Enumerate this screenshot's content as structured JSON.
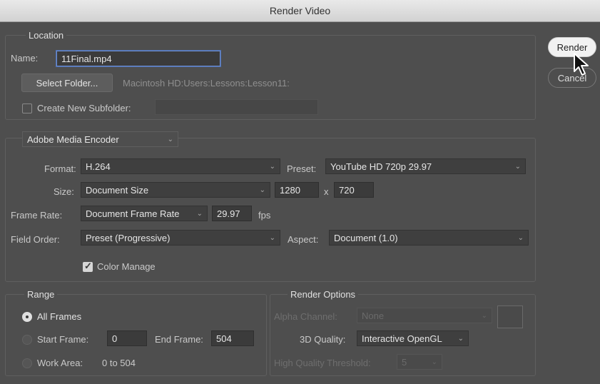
{
  "window": {
    "title": "Render Video"
  },
  "location": {
    "legend": "Location",
    "name_label": "Name:",
    "name_value": "11Final.mp4",
    "select_folder_label": "Select Folder...",
    "folder_path": "Macintosh HD:Users:Lessons:Lesson11:",
    "create_subfolder_label": "Create New Subfolder:",
    "create_subfolder_checked": false,
    "subfolder_value": ""
  },
  "encoder": {
    "selected": "Adobe Media Encoder",
    "format_label": "Format:",
    "format_value": "H.264",
    "preset_label": "Preset:",
    "preset_value": "YouTube HD 720p 29.97",
    "size_label": "Size:",
    "size_value": "Document Size",
    "width": "1280",
    "x_label": "x",
    "height": "720",
    "frame_rate_label": "Frame Rate:",
    "frame_rate_value": "Document Frame Rate",
    "fps_value": "29.97",
    "fps_label": "fps",
    "field_order_label": "Field Order:",
    "field_order_value": "Preset (Progressive)",
    "aspect_label": "Aspect:",
    "aspect_value": "Document (1.0)",
    "color_manage_label": "Color Manage",
    "color_manage_checked": true
  },
  "range": {
    "legend": "Range",
    "all_frames_label": "All Frames",
    "start_frame_label": "Start Frame:",
    "start_frame_value": "0",
    "end_frame_label": "End Frame:",
    "end_frame_value": "504",
    "work_area_label": "Work Area:",
    "work_area_value": "0 to 504",
    "selected": "All Frames"
  },
  "render_options": {
    "legend": "Render Options",
    "alpha_channel_label": "Alpha Channel:",
    "alpha_channel_value": "None",
    "quality_label": "3D Quality:",
    "quality_value": "Interactive OpenGL",
    "threshold_label": "High Quality Threshold:",
    "threshold_value": "5"
  },
  "actions": {
    "render_label": "Render",
    "cancel_label": "Cancel"
  },
  "icons": {
    "chevron": "chevron-down-icon",
    "cursor": "mouse-pointer-icon",
    "check": "checkmark-icon"
  },
  "colors": {
    "dialog_bg": "#4e4e4e",
    "focus": "#6e8fcf"
  }
}
